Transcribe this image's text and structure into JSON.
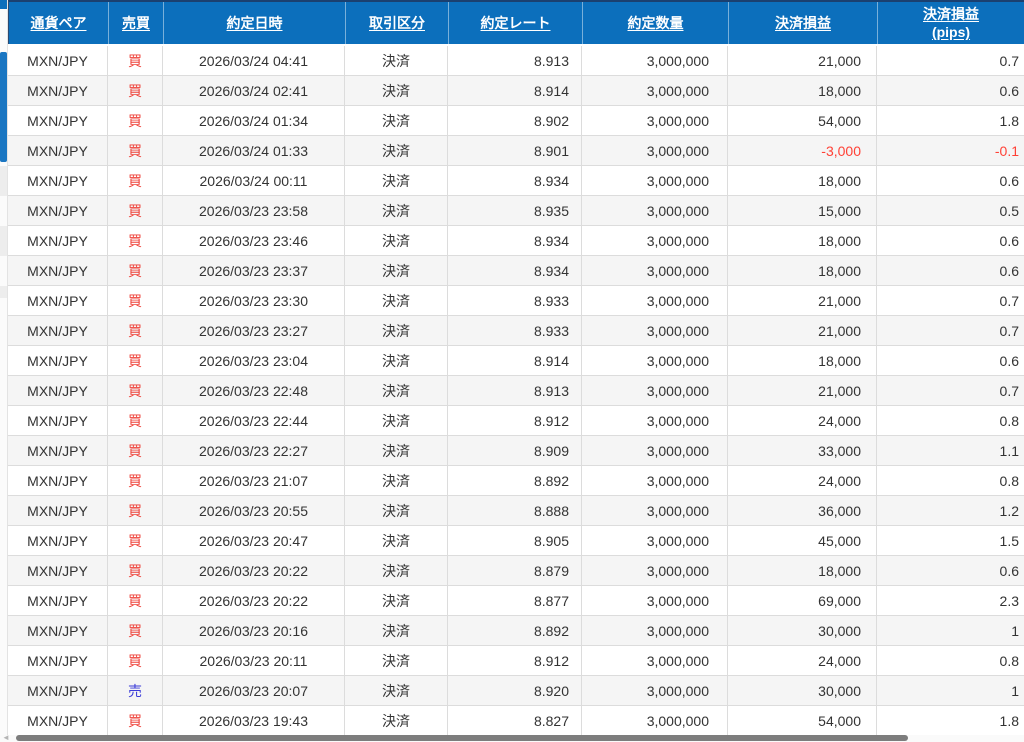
{
  "table": {
    "columns": [
      {
        "key": "pair",
        "label": "通貨ペア"
      },
      {
        "key": "side",
        "label": "売買"
      },
      {
        "key": "datetime",
        "label": "約定日時"
      },
      {
        "key": "type",
        "label": "取引区分"
      },
      {
        "key": "rate",
        "label": "約定レート"
      },
      {
        "key": "qty",
        "label": "約定数量"
      },
      {
        "key": "pl",
        "label": "決済損益"
      },
      {
        "key": "pips",
        "label": "決済損益",
        "label2": "(pips)"
      }
    ],
    "rows": [
      {
        "pair": "MXN/JPY",
        "side": "買",
        "datetime": "2026/03/24 04:41",
        "type": "決済",
        "rate": "8.913",
        "qty": "3,000,000",
        "pl": "21,000",
        "pips": "0.7"
      },
      {
        "pair": "MXN/JPY",
        "side": "買",
        "datetime": "2026/03/24 02:41",
        "type": "決済",
        "rate": "8.914",
        "qty": "3,000,000",
        "pl": "18,000",
        "pips": "0.6"
      },
      {
        "pair": "MXN/JPY",
        "side": "買",
        "datetime": "2026/03/24 01:34",
        "type": "決済",
        "rate": "8.902",
        "qty": "3,000,000",
        "pl": "54,000",
        "pips": "1.8"
      },
      {
        "pair": "MXN/JPY",
        "side": "買",
        "datetime": "2026/03/24 01:33",
        "type": "決済",
        "rate": "8.901",
        "qty": "3,000,000",
        "pl": "-3,000",
        "pips": "-0.1"
      },
      {
        "pair": "MXN/JPY",
        "side": "買",
        "datetime": "2026/03/24 00:11",
        "type": "決済",
        "rate": "8.934",
        "qty": "3,000,000",
        "pl": "18,000",
        "pips": "0.6"
      },
      {
        "pair": "MXN/JPY",
        "side": "買",
        "datetime": "2026/03/23 23:58",
        "type": "決済",
        "rate": "8.935",
        "qty": "3,000,000",
        "pl": "15,000",
        "pips": "0.5"
      },
      {
        "pair": "MXN/JPY",
        "side": "買",
        "datetime": "2026/03/23 23:46",
        "type": "決済",
        "rate": "8.934",
        "qty": "3,000,000",
        "pl": "18,000",
        "pips": "0.6"
      },
      {
        "pair": "MXN/JPY",
        "side": "買",
        "datetime": "2026/03/23 23:37",
        "type": "決済",
        "rate": "8.934",
        "qty": "3,000,000",
        "pl": "18,000",
        "pips": "0.6"
      },
      {
        "pair": "MXN/JPY",
        "side": "買",
        "datetime": "2026/03/23 23:30",
        "type": "決済",
        "rate": "8.933",
        "qty": "3,000,000",
        "pl": "21,000",
        "pips": "0.7"
      },
      {
        "pair": "MXN/JPY",
        "side": "買",
        "datetime": "2026/03/23 23:27",
        "type": "決済",
        "rate": "8.933",
        "qty": "3,000,000",
        "pl": "21,000",
        "pips": "0.7"
      },
      {
        "pair": "MXN/JPY",
        "side": "買",
        "datetime": "2026/03/23 23:04",
        "type": "決済",
        "rate": "8.914",
        "qty": "3,000,000",
        "pl": "18,000",
        "pips": "0.6"
      },
      {
        "pair": "MXN/JPY",
        "side": "買",
        "datetime": "2026/03/23 22:48",
        "type": "決済",
        "rate": "8.913",
        "qty": "3,000,000",
        "pl": "21,000",
        "pips": "0.7"
      },
      {
        "pair": "MXN/JPY",
        "side": "買",
        "datetime": "2026/03/23 22:44",
        "type": "決済",
        "rate": "8.912",
        "qty": "3,000,000",
        "pl": "24,000",
        "pips": "0.8"
      },
      {
        "pair": "MXN/JPY",
        "side": "買",
        "datetime": "2026/03/23 22:27",
        "type": "決済",
        "rate": "8.909",
        "qty": "3,000,000",
        "pl": "33,000",
        "pips": "1.1"
      },
      {
        "pair": "MXN/JPY",
        "side": "買",
        "datetime": "2026/03/23 21:07",
        "type": "決済",
        "rate": "8.892",
        "qty": "3,000,000",
        "pl": "24,000",
        "pips": "0.8"
      },
      {
        "pair": "MXN/JPY",
        "side": "買",
        "datetime": "2026/03/23 20:55",
        "type": "決済",
        "rate": "8.888",
        "qty": "3,000,000",
        "pl": "36,000",
        "pips": "1.2"
      },
      {
        "pair": "MXN/JPY",
        "side": "買",
        "datetime": "2026/03/23 20:47",
        "type": "決済",
        "rate": "8.905",
        "qty": "3,000,000",
        "pl": "45,000",
        "pips": "1.5"
      },
      {
        "pair": "MXN/JPY",
        "side": "買",
        "datetime": "2026/03/23 20:22",
        "type": "決済",
        "rate": "8.879",
        "qty": "3,000,000",
        "pl": "18,000",
        "pips": "0.6"
      },
      {
        "pair": "MXN/JPY",
        "side": "買",
        "datetime": "2026/03/23 20:22",
        "type": "決済",
        "rate": "8.877",
        "qty": "3,000,000",
        "pl": "69,000",
        "pips": "2.3"
      },
      {
        "pair": "MXN/JPY",
        "side": "買",
        "datetime": "2026/03/23 20:16",
        "type": "決済",
        "rate": "8.892",
        "qty": "3,000,000",
        "pl": "30,000",
        "pips": "1"
      },
      {
        "pair": "MXN/JPY",
        "side": "買",
        "datetime": "2026/03/23 20:11",
        "type": "決済",
        "rate": "8.912",
        "qty": "3,000,000",
        "pl": "24,000",
        "pips": "0.8"
      },
      {
        "pair": "MXN/JPY",
        "side": "売",
        "datetime": "2026/03/23 20:07",
        "type": "決済",
        "rate": "8.920",
        "qty": "3,000,000",
        "pl": "30,000",
        "pips": "1"
      },
      {
        "pair": "MXN/JPY",
        "side": "買",
        "datetime": "2026/03/23 19:43",
        "type": "決済",
        "rate": "8.827",
        "qty": "3,000,000",
        "pl": "54,000",
        "pips": "1.8"
      }
    ]
  },
  "colors": {
    "header_bg": "#0c6fbc",
    "header_text": "#ffffff",
    "buy": "#ef4038",
    "sell": "#3c3cd8",
    "negative": "#ff4136",
    "row_stripe": "#f5f5f5",
    "body_text": "#333333",
    "scroll_thumb": "#7d7d7d",
    "vscroll_thumb": "#1a76c2"
  }
}
